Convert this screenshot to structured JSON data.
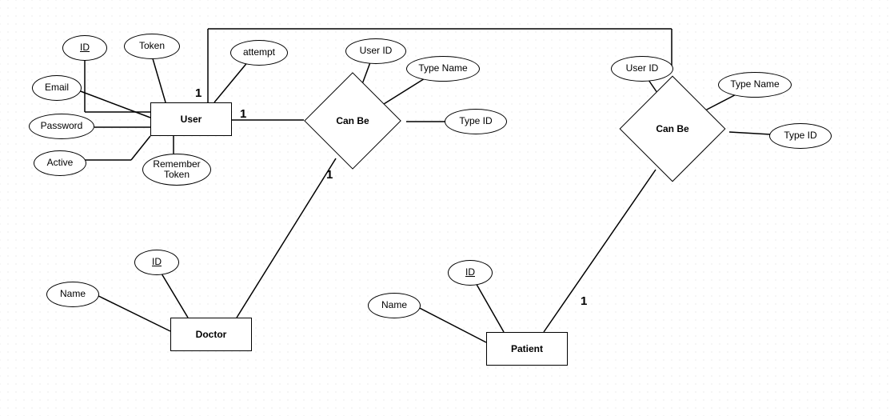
{
  "diagram": {
    "type": "er-diagram",
    "entities": {
      "user": {
        "label": "User"
      },
      "doctor": {
        "label": "Doctor"
      },
      "patient": {
        "label": "Patient"
      }
    },
    "relationships": {
      "canbe1": {
        "label": "Can Be"
      },
      "canbe2": {
        "label": "Can Be"
      }
    },
    "attributes": {
      "user_id": {
        "label": "ID",
        "key": true
      },
      "user_token": {
        "label": "Token",
        "key": false
      },
      "user_email": {
        "label": "Email",
        "key": false
      },
      "user_password": {
        "label": "Password",
        "key": false
      },
      "user_active": {
        "label": "Active",
        "key": false
      },
      "user_remember": {
        "label": "Remember\nToken",
        "key": false
      },
      "user_attempt": {
        "label": "attempt",
        "key": false
      },
      "cb1_userid": {
        "label": "User ID",
        "key": false
      },
      "cb1_typename": {
        "label": "Type Name",
        "key": false
      },
      "cb1_typeid": {
        "label": "Type ID",
        "key": false
      },
      "cb2_userid": {
        "label": "User ID",
        "key": false
      },
      "cb2_typename": {
        "label": "Type Name",
        "key": false
      },
      "cb2_typeid": {
        "label": "Type ID",
        "key": false
      },
      "doctor_id": {
        "label": "ID",
        "key": true
      },
      "doctor_name": {
        "label": "Name",
        "key": false
      },
      "patient_id": {
        "label": "ID",
        "key": true
      },
      "patient_name": {
        "label": "Name",
        "key": false
      }
    },
    "cardinalities": {
      "user_top": {
        "label": "1"
      },
      "user_to_cb1": {
        "label": "1"
      },
      "cb1_to_doctor": {
        "label": "1"
      },
      "cb2_to_patient": {
        "label": "1"
      }
    }
  }
}
